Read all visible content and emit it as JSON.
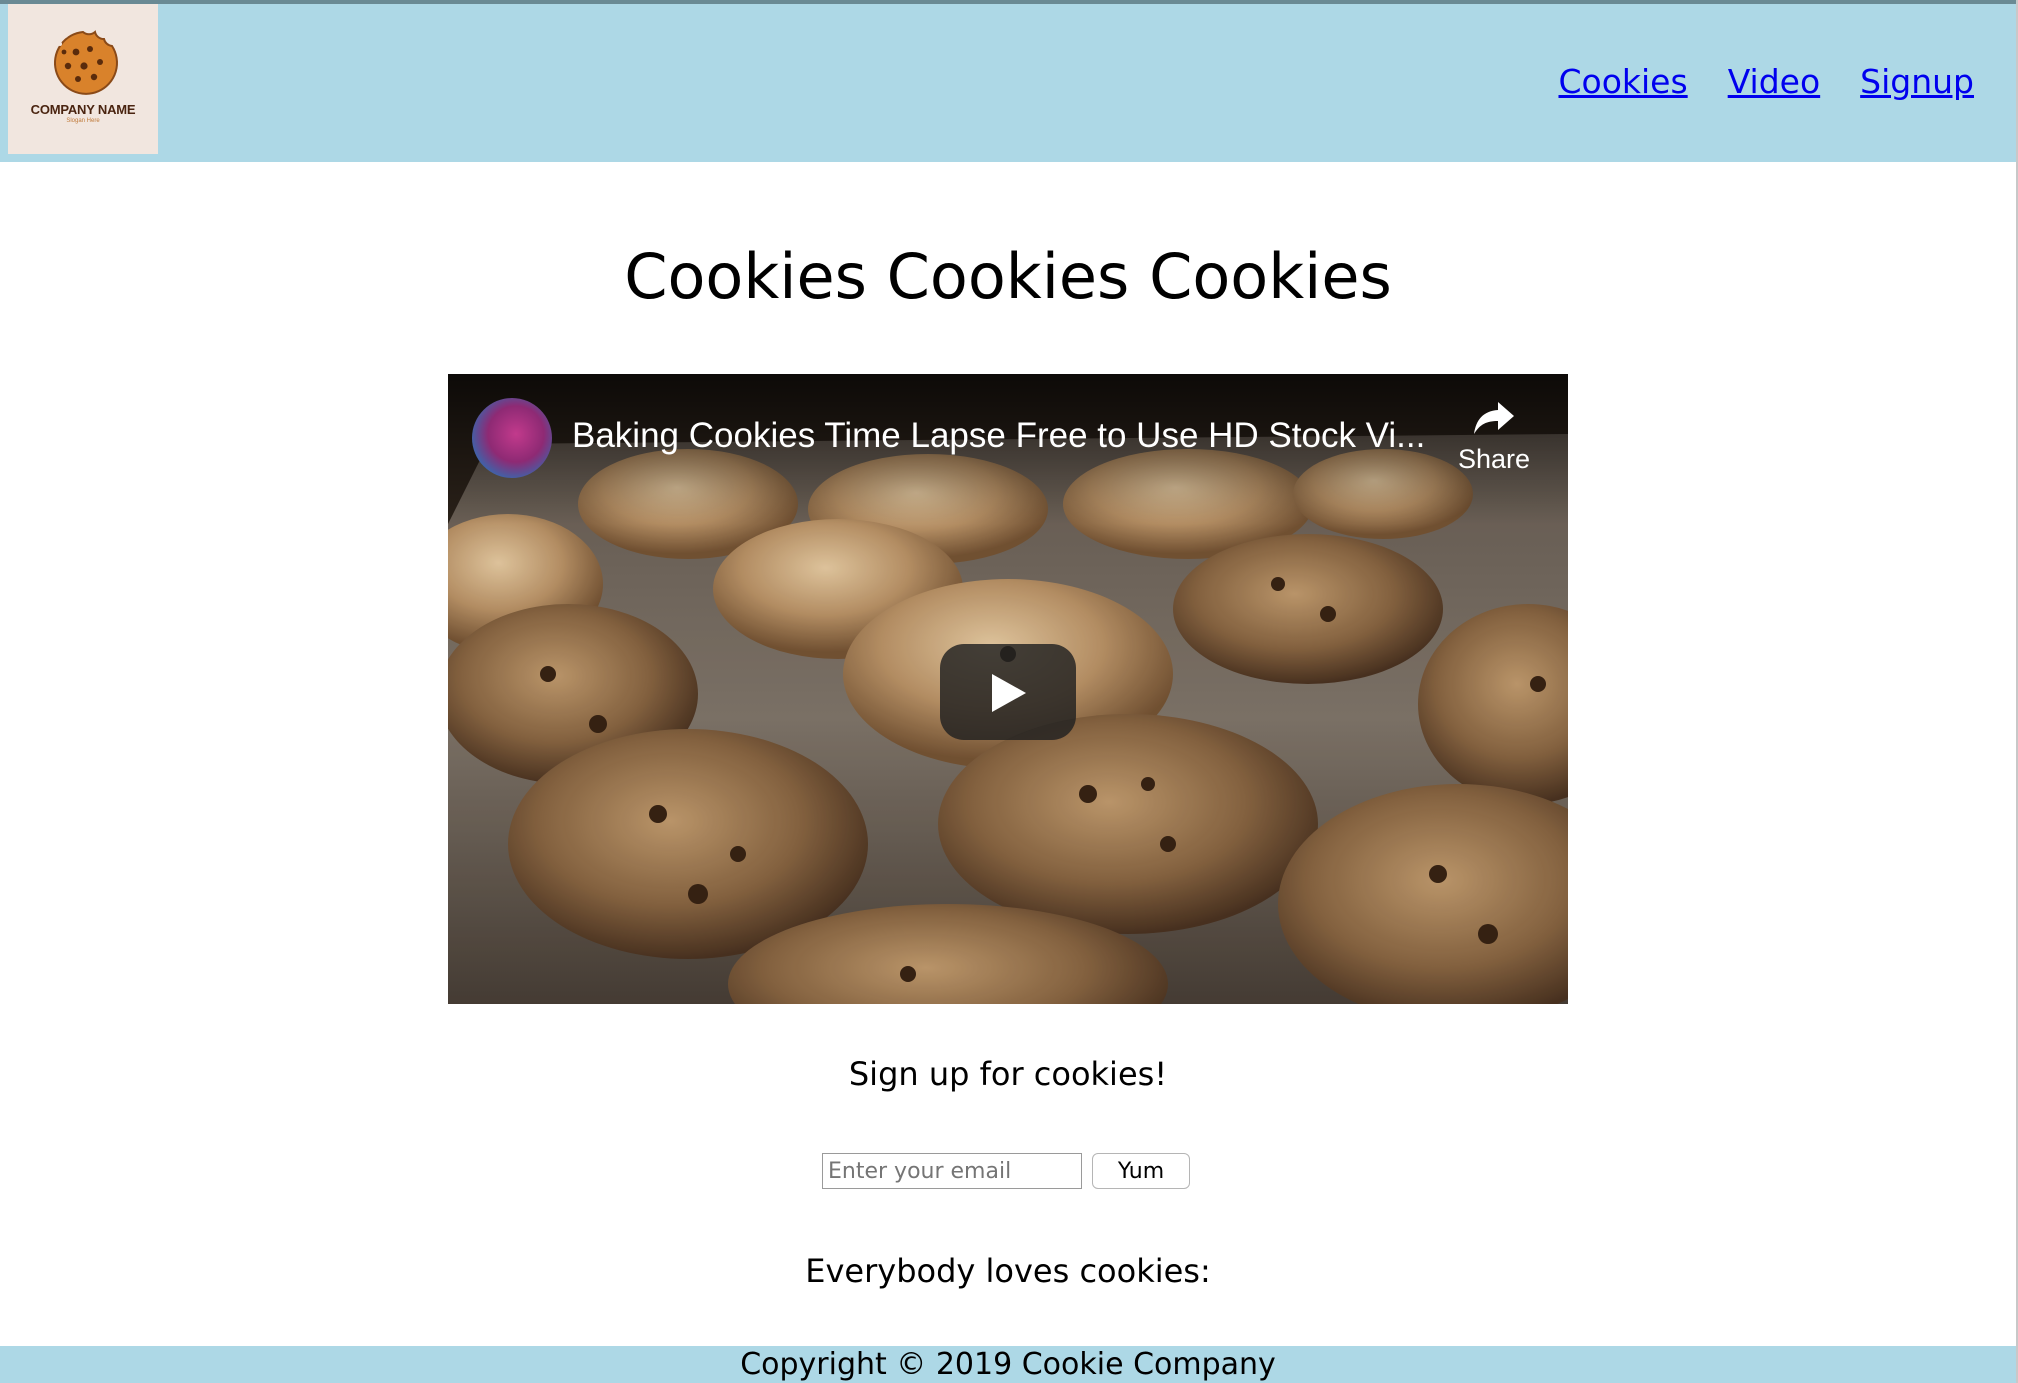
{
  "header": {
    "logo": {
      "company_name": "COMPANY NAME",
      "tagline": "Slogan Here",
      "icon": "cookie-icon"
    },
    "nav": [
      {
        "label": "Cookies"
      },
      {
        "label": "Video"
      },
      {
        "label": "Signup"
      }
    ],
    "background_color": "#add8e6"
  },
  "main": {
    "title": "Cookies Cookies Cookies",
    "video": {
      "title": "Baking Cookies Time Lapse Free to Use HD Stock Vi...",
      "share_label": "Share",
      "share_icon": "share-arrow-icon",
      "play_icon": "play-icon"
    },
    "signup": {
      "heading": "Sign up for cookies!",
      "email_placeholder": "Enter your email",
      "email_value": "",
      "button_label": "Yum"
    },
    "loves_text": "Everybody loves cookies:"
  },
  "footer": {
    "copyright": "Copyright © 2019 Cookie Company",
    "background_color": "#add8e6"
  }
}
